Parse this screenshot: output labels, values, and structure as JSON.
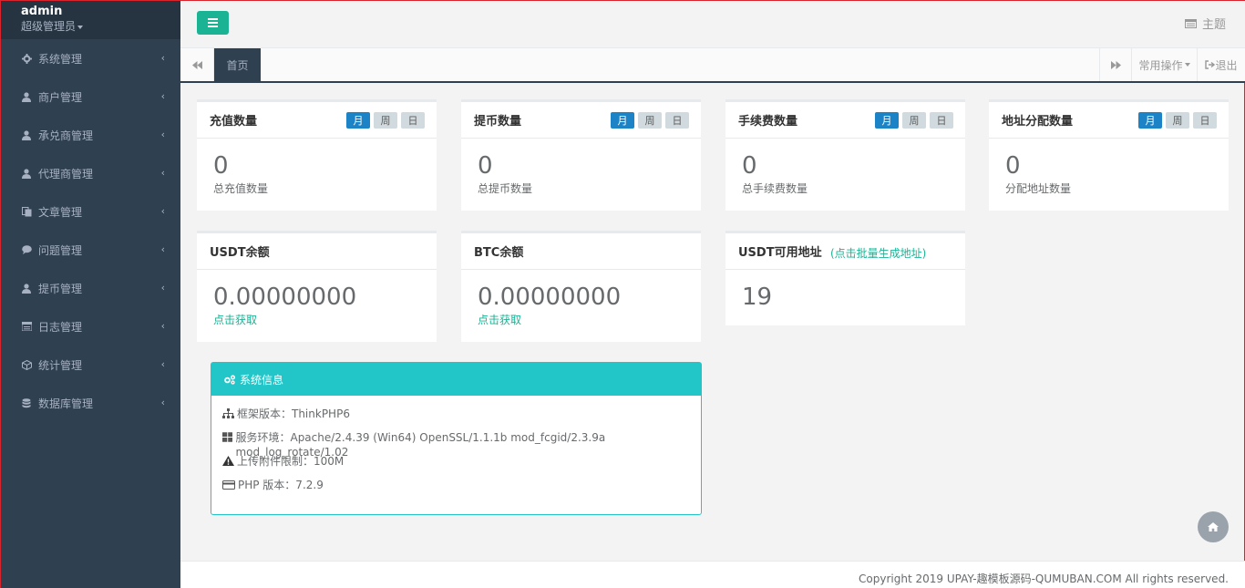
{
  "profile": {
    "name": "admin",
    "role": "超级管理员"
  },
  "sidebar": {
    "items": [
      {
        "label": "系统管理",
        "icon": "gear-icon"
      },
      {
        "label": "商户管理",
        "icon": "user-icon"
      },
      {
        "label": "承兑商管理",
        "icon": "user-icon"
      },
      {
        "label": "代理商管理",
        "icon": "user-icon"
      },
      {
        "label": "文章管理",
        "icon": "copy-icon"
      },
      {
        "label": "问题管理",
        "icon": "comment-icon"
      },
      {
        "label": "提币管理",
        "icon": "user-icon"
      },
      {
        "label": "日志管理",
        "icon": "list-icon"
      },
      {
        "label": "统计管理",
        "icon": "cube-icon"
      },
      {
        "label": "数据库管理",
        "icon": "database-icon"
      }
    ]
  },
  "topbar": {
    "theme_label": "主题"
  },
  "tabs": {
    "active_tab": "首页",
    "ops_label": "常用操作",
    "logout_label": "退出"
  },
  "stats": [
    {
      "title": "充值数量",
      "pills": [
        "月",
        "周",
        "日"
      ],
      "value": "0",
      "caption": "总充值数量"
    },
    {
      "title": "提币数量",
      "pills": [
        "月",
        "周",
        "日"
      ],
      "value": "0",
      "caption": "总提币数量"
    },
    {
      "title": "手续费数量",
      "pills": [
        "月",
        "周",
        "日"
      ],
      "value": "0",
      "caption": "总手续费数量"
    },
    {
      "title": "地址分配数量",
      "pills": [
        "月",
        "周",
        "日"
      ],
      "value": "0",
      "caption": "分配地址数量"
    }
  ],
  "balances": [
    {
      "title": "USDT余额",
      "value": "0.00000000",
      "link": "点击获取"
    },
    {
      "title": "BTC余额",
      "value": "0.00000000",
      "link": "点击获取"
    },
    {
      "title": "USDT可用地址",
      "value": "19",
      "link": "(点击批量生成地址)"
    }
  ],
  "sysinfo": {
    "title": "系统信息",
    "rows": [
      {
        "icon": "sitemap-icon",
        "text": "框架版本：ThinkPHP6"
      },
      {
        "icon": "windows-icon",
        "text": "服务环境：Apache/2.4.39 (Win64) OpenSSL/1.1.1b mod_fcgid/2.3.9a mod_log_rotate/1.02"
      },
      {
        "icon": "warning-icon",
        "text": "上传附件限制：100M"
      },
      {
        "icon": "credit-card-icon",
        "text": "PHP 版本：7.2.9"
      }
    ]
  },
  "footer": {
    "copyright": "Copyright 2019 UPAY-趣模板源码-QUMUBAN.COM All rights reserved."
  },
  "colors": {
    "sidebar": "#2f4050",
    "accent": "#1ab394",
    "primary": "#1c84c6",
    "info": "#23c6c8"
  }
}
